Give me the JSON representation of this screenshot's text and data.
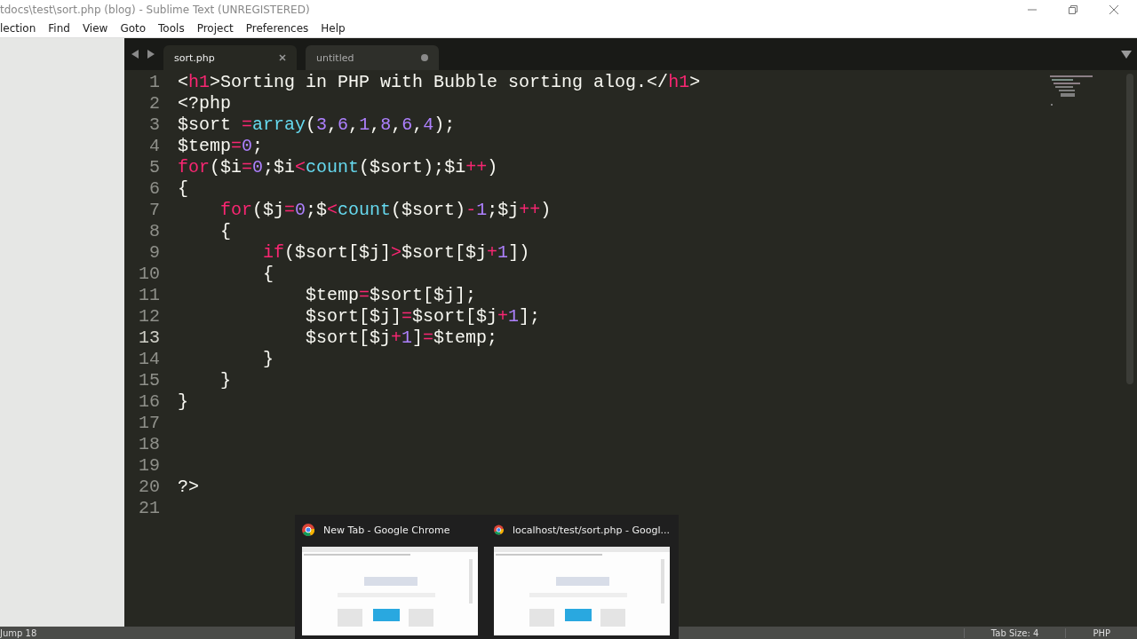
{
  "window": {
    "title": "tdocs\\test\\sort.php (blog) - Sublime Text (UNREGISTERED)"
  },
  "menu": [
    "lection",
    "Find",
    "View",
    "Goto",
    "Tools",
    "Project",
    "Preferences",
    "Help"
  ],
  "tabs": [
    {
      "label": "sort.php",
      "selected": true,
      "dirty": false
    },
    {
      "label": "untitled",
      "selected": false,
      "dirty": true
    }
  ],
  "editor": {
    "lines": [
      {
        "number": "1",
        "current": false,
        "tokens": [
          {
            "kind": "plain",
            "text": "<"
          },
          {
            "kind": "keyword",
            "text": "h1"
          },
          {
            "kind": "plain",
            "text": ">Sorting in PHP with Bubble sorting alog.</"
          },
          {
            "kind": "keyword",
            "text": "h1"
          },
          {
            "kind": "plain",
            "text": ">"
          }
        ]
      },
      {
        "number": "2",
        "current": false,
        "tokens": [
          {
            "kind": "plain",
            "text": "<?php"
          }
        ]
      },
      {
        "number": "3",
        "current": false,
        "tokens": [
          {
            "kind": "plain",
            "text": "$sort "
          },
          {
            "kind": "keyword",
            "text": "="
          },
          {
            "kind": "function",
            "text": "array"
          },
          {
            "kind": "plain",
            "text": "("
          },
          {
            "kind": "number",
            "text": "3"
          },
          {
            "kind": "plain",
            "text": ","
          },
          {
            "kind": "number",
            "text": "6"
          },
          {
            "kind": "plain",
            "text": ","
          },
          {
            "kind": "number",
            "text": "1"
          },
          {
            "kind": "plain",
            "text": ","
          },
          {
            "kind": "number",
            "text": "8"
          },
          {
            "kind": "plain",
            "text": ","
          },
          {
            "kind": "number",
            "text": "6"
          },
          {
            "kind": "plain",
            "text": ","
          },
          {
            "kind": "number",
            "text": "4"
          },
          {
            "kind": "plain",
            "text": ");"
          }
        ]
      },
      {
        "number": "4",
        "current": false,
        "tokens": [
          {
            "kind": "plain",
            "text": "$temp"
          },
          {
            "kind": "keyword",
            "text": "="
          },
          {
            "kind": "number",
            "text": "0"
          },
          {
            "kind": "plain",
            "text": ";"
          }
        ]
      },
      {
        "number": "5",
        "current": false,
        "tokens": [
          {
            "kind": "keyword",
            "text": "for"
          },
          {
            "kind": "plain",
            "text": "($i"
          },
          {
            "kind": "keyword",
            "text": "="
          },
          {
            "kind": "number",
            "text": "0"
          },
          {
            "kind": "plain",
            "text": ";$i"
          },
          {
            "kind": "keyword",
            "text": "<"
          },
          {
            "kind": "function",
            "text": "count"
          },
          {
            "kind": "plain",
            "text": "($sort);$i"
          },
          {
            "kind": "keyword",
            "text": "++"
          },
          {
            "kind": "plain",
            "text": ")"
          }
        ]
      },
      {
        "number": "6",
        "current": false,
        "tokens": [
          {
            "kind": "plain",
            "text": "{"
          }
        ]
      },
      {
        "number": "7",
        "current": false,
        "tokens": [
          {
            "kind": "keyword",
            "text": "    for"
          },
          {
            "kind": "plain",
            "text": "($j"
          },
          {
            "kind": "keyword",
            "text": "="
          },
          {
            "kind": "number",
            "text": "0"
          },
          {
            "kind": "plain",
            "text": ";$"
          },
          {
            "kind": "keyword",
            "text": "<"
          },
          {
            "kind": "function",
            "text": "count"
          },
          {
            "kind": "plain",
            "text": "($sort)"
          },
          {
            "kind": "keyword",
            "text": "-"
          },
          {
            "kind": "number",
            "text": "1"
          },
          {
            "kind": "plain",
            "text": ";$j"
          },
          {
            "kind": "keyword",
            "text": "++"
          },
          {
            "kind": "plain",
            "text": ")"
          }
        ]
      },
      {
        "number": "8",
        "current": false,
        "tokens": [
          {
            "kind": "plain",
            "text": "    {"
          }
        ]
      },
      {
        "number": "9",
        "current": false,
        "tokens": [
          {
            "kind": "keyword",
            "text": "        if"
          },
          {
            "kind": "plain",
            "text": "($sort[$j]"
          },
          {
            "kind": "keyword",
            "text": ">"
          },
          {
            "kind": "plain",
            "text": "$sort[$j"
          },
          {
            "kind": "keyword",
            "text": "+"
          },
          {
            "kind": "number",
            "text": "1"
          },
          {
            "kind": "plain",
            "text": "])"
          }
        ]
      },
      {
        "number": "10",
        "current": false,
        "tokens": [
          {
            "kind": "plain",
            "text": "        {"
          }
        ]
      },
      {
        "number": "11",
        "current": false,
        "tokens": [
          {
            "kind": "plain",
            "text": "            $temp"
          },
          {
            "kind": "keyword",
            "text": "="
          },
          {
            "kind": "plain",
            "text": "$sort[$j];"
          }
        ]
      },
      {
        "number": "12",
        "current": false,
        "tokens": [
          {
            "kind": "plain",
            "text": "            $sort[$j]"
          },
          {
            "kind": "keyword",
            "text": "="
          },
          {
            "kind": "plain",
            "text": "$sort[$j"
          },
          {
            "kind": "keyword",
            "text": "+"
          },
          {
            "kind": "number",
            "text": "1"
          },
          {
            "kind": "plain",
            "text": "];"
          }
        ]
      },
      {
        "number": "13",
        "current": true,
        "tokens": [
          {
            "kind": "plain",
            "text": "            $sort[$j"
          },
          {
            "kind": "keyword",
            "text": "+"
          },
          {
            "kind": "number",
            "text": "1"
          },
          {
            "kind": "plain",
            "text": "]"
          },
          {
            "kind": "keyword",
            "text": "="
          },
          {
            "kind": "plain",
            "text": "$temp;"
          }
        ]
      },
      {
        "number": "14",
        "current": false,
        "tokens": [
          {
            "kind": "plain",
            "text": "        }"
          }
        ]
      },
      {
        "number": "15",
        "current": false,
        "tokens": [
          {
            "kind": "plain",
            "text": "    }"
          }
        ]
      },
      {
        "number": "16",
        "current": false,
        "tokens": [
          {
            "kind": "plain",
            "text": "}"
          }
        ]
      },
      {
        "number": "17",
        "current": false
      },
      {
        "number": "18",
        "current": false
      },
      {
        "number": "19",
        "current": false
      },
      {
        "number": "20",
        "current": false,
        "tokens": [
          {
            "kind": "plain",
            "text": "?>"
          }
        ]
      },
      {
        "number": "21",
        "current": false
      }
    ]
  },
  "status_bar": {
    "left": "Jump 18",
    "tab_size": "Tab Size: 4",
    "syntax": "PHP"
  },
  "taskbar_preview": [
    {
      "title": "New Tab - Google Chrome"
    },
    {
      "title": "localhost/test/sort.php - Googl..."
    }
  ]
}
